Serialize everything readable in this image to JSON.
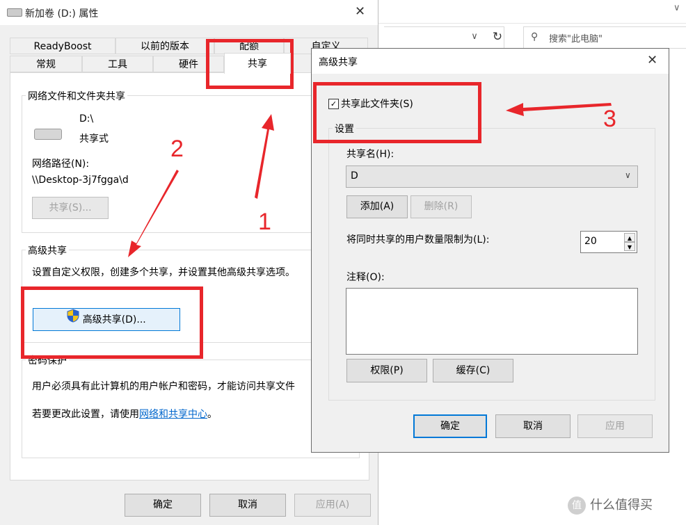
{
  "explorer": {
    "search_placeholder": "搜索\"此电脑\""
  },
  "props": {
    "title": "新加卷 (D:) 属性",
    "tabs_row1": [
      "ReadyBoost",
      "以前的版本",
      "配额",
      "自定义"
    ],
    "tabs_row2": [
      "常规",
      "工具",
      "硬件",
      "共享"
    ],
    "net_group_title": "网络文件和文件夹共享",
    "drive_path": "D:\\",
    "share_state": "共享式",
    "net_path_label": "网络路径(N):",
    "net_path_value": "\\\\Desktop-3j7fgga\\d",
    "share_button": "共享(S)...",
    "adv_group_title": "高级共享",
    "adv_desc": "设置自定义权限，创建多个共享，并设置其他高级共享选项。",
    "adv_button": "高级共享(D)...",
    "pw_group_title": "密码保护",
    "pw_desc": "用户必须具有此计算机的用户帐户和密码，才能访问共享文件",
    "pw_change_prefix": "若要更改此设置，请使用",
    "pw_change_link": "网络和共享中心",
    "pw_change_suffix": "。",
    "ok": "确定",
    "cancel": "取消",
    "apply": "应用(A)"
  },
  "adv": {
    "title": "高级共享",
    "share_checkbox": "共享此文件夹(S)",
    "settings_title": "设置",
    "share_name_label": "共享名(H):",
    "share_name_value": "D",
    "add": "添加(A)",
    "remove": "删除(R)",
    "limit_label": "将同时共享的用户数量限制为(L):",
    "limit_value": "20",
    "comment_label": "注释(O):",
    "permissions": "权限(P)",
    "caching": "缓存(C)",
    "ok": "确定",
    "cancel": "取消",
    "apply": "应用"
  },
  "annotations": {
    "n1": "1",
    "n2": "2",
    "n3": "3",
    "color": "#e8262b"
  },
  "watermark": {
    "text": "什么值得买",
    "icon": "值"
  }
}
